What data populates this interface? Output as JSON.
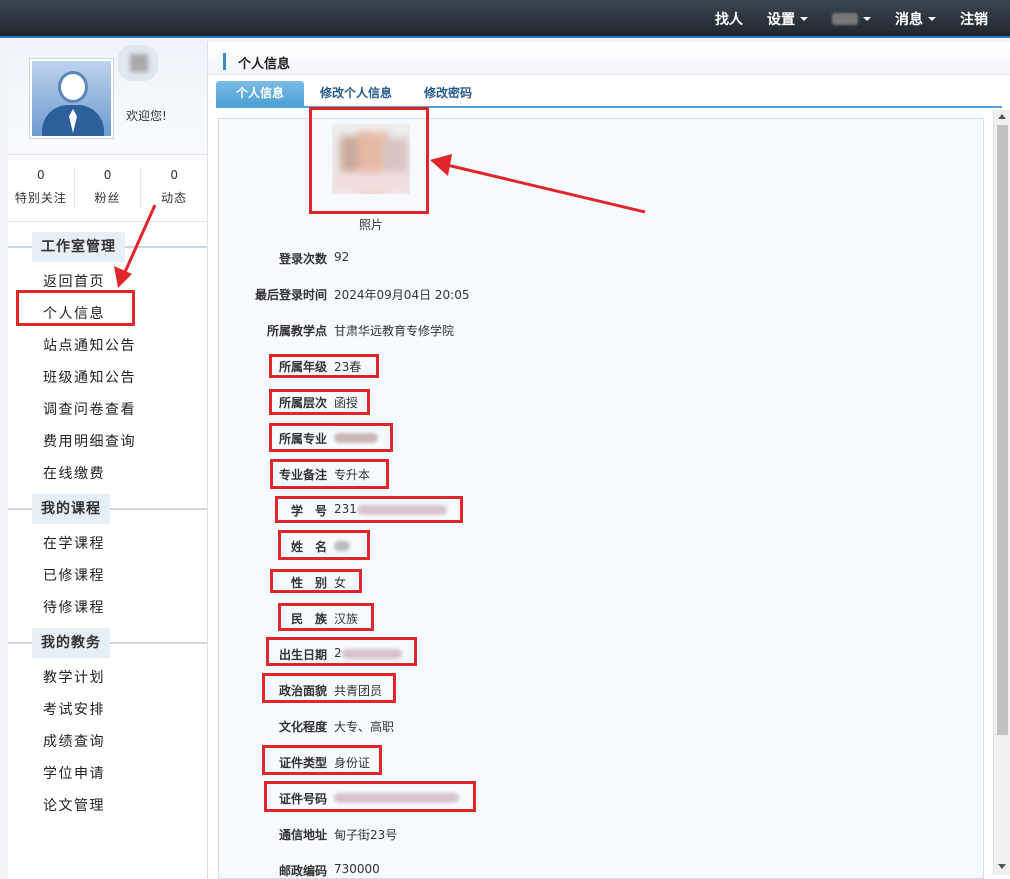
{
  "topnav": {
    "find_people": "找人",
    "settings": "设置",
    "messages": "消息",
    "logout": "注销"
  },
  "profile": {
    "welcome": "欢迎您!"
  },
  "stats": [
    {
      "num": "0",
      "label": "特别关注"
    },
    {
      "num": "0",
      "label": "粉丝"
    },
    {
      "num": "0",
      "label": "动态"
    }
  ],
  "sidebar": {
    "sections": [
      {
        "title": "工作室管理",
        "items": [
          "返回首页",
          "个人信息",
          "站点通知公告",
          "班级通知公告",
          "调查问卷查看",
          "费用明细查询",
          "在线缴费"
        ]
      },
      {
        "title": "我的课程",
        "items": [
          "在学课程",
          "已修课程",
          "待修课程"
        ]
      },
      {
        "title": "我的教务",
        "items": [
          "教学计划",
          "考试安排",
          "成绩查询",
          "学位申请",
          "论文管理"
        ]
      }
    ]
  },
  "main": {
    "title": "个人信息",
    "tabs": [
      "个人信息",
      "修改个人信息",
      "修改密码"
    ],
    "photo_label": "照片",
    "fields": [
      {
        "label": "登录次数",
        "value": "92"
      },
      {
        "label": "最后登录时间",
        "value": "2024年09月04日 20:05"
      },
      {
        "label": "所属教学点",
        "value": "甘肃华远教育专修学院"
      },
      {
        "label": "所属年级",
        "value": "23春"
      },
      {
        "label": "所属层次",
        "value": "函授"
      },
      {
        "label": "所属专业",
        "value": ""
      },
      {
        "label": "专业备注",
        "value": "专升本"
      },
      {
        "label": "学　号",
        "value": "231"
      },
      {
        "label": "姓　名",
        "value": ""
      },
      {
        "label": "性　别",
        "value": "女"
      },
      {
        "label": "民　族",
        "value": "汉族"
      },
      {
        "label": "出生日期",
        "value": "2"
      },
      {
        "label": "政治面貌",
        "value": "共青团员"
      },
      {
        "label": "文化程度",
        "value": "大专、高职"
      },
      {
        "label": "证件类型",
        "value": "身份证"
      },
      {
        "label": "证件号码",
        "value": ""
      },
      {
        "label": "通信地址",
        "value": "甸子街23号"
      },
      {
        "label": "邮政编码",
        "value": "730000"
      }
    ]
  },
  "colors": {
    "accent": "#4fa3d8",
    "highlight": "#e0262a",
    "topbar": "#2b343c"
  }
}
